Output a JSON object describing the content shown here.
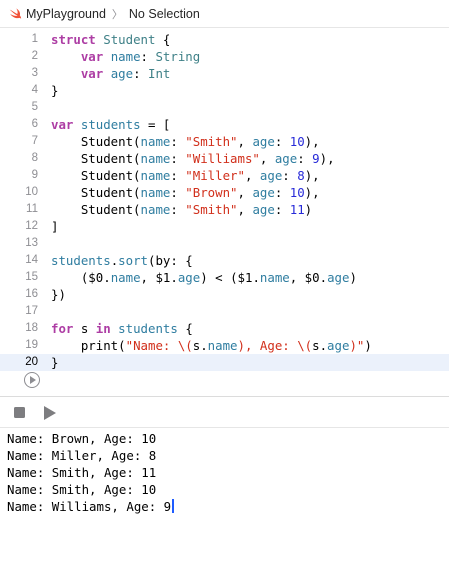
{
  "breadcrumb": {
    "project": "MyPlayground",
    "separator": "〉",
    "selection": "No Selection"
  },
  "editor": {
    "current_line": 20,
    "lines": [
      {
        "num": "1",
        "tokens": [
          [
            "kw",
            "struct"
          ],
          [
            "plain",
            " "
          ],
          [
            "type",
            "Student"
          ],
          [
            "plain",
            " {"
          ]
        ]
      },
      {
        "num": "2",
        "tokens": [
          [
            "plain",
            "    "
          ],
          [
            "kw",
            "var"
          ],
          [
            "plain",
            " "
          ],
          [
            "prop",
            "name"
          ],
          [
            "plain",
            ": "
          ],
          [
            "type",
            "String"
          ]
        ]
      },
      {
        "num": "3",
        "tokens": [
          [
            "plain",
            "    "
          ],
          [
            "kw",
            "var"
          ],
          [
            "plain",
            " "
          ],
          [
            "prop",
            "age"
          ],
          [
            "plain",
            ": "
          ],
          [
            "type",
            "Int"
          ]
        ]
      },
      {
        "num": "4",
        "tokens": [
          [
            "plain",
            "}"
          ]
        ]
      },
      {
        "num": "5",
        "tokens": []
      },
      {
        "num": "6",
        "tokens": [
          [
            "kw",
            "var"
          ],
          [
            "plain",
            " "
          ],
          [
            "prop",
            "students"
          ],
          [
            "plain",
            " = ["
          ]
        ]
      },
      {
        "num": "7",
        "tokens": [
          [
            "plain",
            "    Student("
          ],
          [
            "prop",
            "name"
          ],
          [
            "plain",
            ": "
          ],
          [
            "str",
            "\"Smith\""
          ],
          [
            "plain",
            ", "
          ],
          [
            "prop",
            "age"
          ],
          [
            "plain",
            ": "
          ],
          [
            "num",
            "10"
          ],
          [
            "plain",
            "),"
          ]
        ]
      },
      {
        "num": "8",
        "tokens": [
          [
            "plain",
            "    Student("
          ],
          [
            "prop",
            "name"
          ],
          [
            "plain",
            ": "
          ],
          [
            "str",
            "\"Williams\""
          ],
          [
            "plain",
            ", "
          ],
          [
            "prop",
            "age"
          ],
          [
            "plain",
            ": "
          ],
          [
            "num",
            "9"
          ],
          [
            "plain",
            "),"
          ]
        ]
      },
      {
        "num": "9",
        "tokens": [
          [
            "plain",
            "    Student("
          ],
          [
            "prop",
            "name"
          ],
          [
            "plain",
            ": "
          ],
          [
            "str",
            "\"Miller\""
          ],
          [
            "plain",
            ", "
          ],
          [
            "prop",
            "age"
          ],
          [
            "plain",
            ": "
          ],
          [
            "num",
            "8"
          ],
          [
            "plain",
            "),"
          ]
        ]
      },
      {
        "num": "10",
        "tokens": [
          [
            "plain",
            "    Student("
          ],
          [
            "prop",
            "name"
          ],
          [
            "plain",
            ": "
          ],
          [
            "str",
            "\"Brown\""
          ],
          [
            "plain",
            ", "
          ],
          [
            "prop",
            "age"
          ],
          [
            "plain",
            ": "
          ],
          [
            "num",
            "10"
          ],
          [
            "plain",
            "),"
          ]
        ]
      },
      {
        "num": "11",
        "tokens": [
          [
            "plain",
            "    Student("
          ],
          [
            "prop",
            "name"
          ],
          [
            "plain",
            ": "
          ],
          [
            "str",
            "\"Smith\""
          ],
          [
            "plain",
            ", "
          ],
          [
            "prop",
            "age"
          ],
          [
            "plain",
            ": "
          ],
          [
            "num",
            "11"
          ],
          [
            "plain",
            ")"
          ]
        ]
      },
      {
        "num": "12",
        "tokens": [
          [
            "plain",
            "]"
          ]
        ]
      },
      {
        "num": "13",
        "tokens": []
      },
      {
        "num": "14",
        "tokens": [
          [
            "prop",
            "students"
          ],
          [
            "plain",
            "."
          ],
          [
            "prop",
            "sort"
          ],
          [
            "plain",
            "(by: {"
          ]
        ]
      },
      {
        "num": "15",
        "tokens": [
          [
            "plain",
            "    ($0."
          ],
          [
            "prop",
            "name"
          ],
          [
            "plain",
            ", $1."
          ],
          [
            "prop",
            "age"
          ],
          [
            "plain",
            ") < ($1."
          ],
          [
            "prop",
            "name"
          ],
          [
            "plain",
            ", $0."
          ],
          [
            "prop",
            "age"
          ],
          [
            "plain",
            ")"
          ]
        ]
      },
      {
        "num": "16",
        "tokens": [
          [
            "plain",
            "})"
          ]
        ]
      },
      {
        "num": "17",
        "tokens": []
      },
      {
        "num": "18",
        "tokens": [
          [
            "kw",
            "for"
          ],
          [
            "plain",
            " s "
          ],
          [
            "kw",
            "in"
          ],
          [
            "plain",
            " "
          ],
          [
            "prop",
            "students"
          ],
          [
            "plain",
            " {"
          ]
        ]
      },
      {
        "num": "19",
        "tokens": [
          [
            "plain",
            "    print("
          ],
          [
            "str",
            "\"Name: \\("
          ],
          [
            "plain",
            "s."
          ],
          [
            "prop",
            "name"
          ],
          [
            "str",
            "), Age: \\("
          ],
          [
            "plain",
            "s."
          ],
          [
            "prop",
            "age"
          ],
          [
            "str",
            ")\""
          ],
          [
            "plain",
            ")"
          ]
        ]
      },
      {
        "num": "20",
        "tokens": [
          [
            "plain",
            "}"
          ]
        ]
      }
    ]
  },
  "console": {
    "lines": [
      "Name: Brown, Age: 10",
      "Name: Miller, Age: 8",
      "Name: Smith, Age: 11",
      "Name: Smith, Age: 10",
      "Name: Williams, Age: 9"
    ]
  },
  "colors": {
    "keyword": "#ad3da4",
    "type": "#3e8087",
    "property": "#2f7da0",
    "string": "#d12f1b",
    "number": "#272ad8",
    "current_line_bg": "#ebf1fb",
    "caret": "#1f5cff"
  },
  "icons": {
    "project": "swift-icon",
    "run_line": "run-circle-icon",
    "stop": "stop-icon",
    "run": "play-icon"
  }
}
